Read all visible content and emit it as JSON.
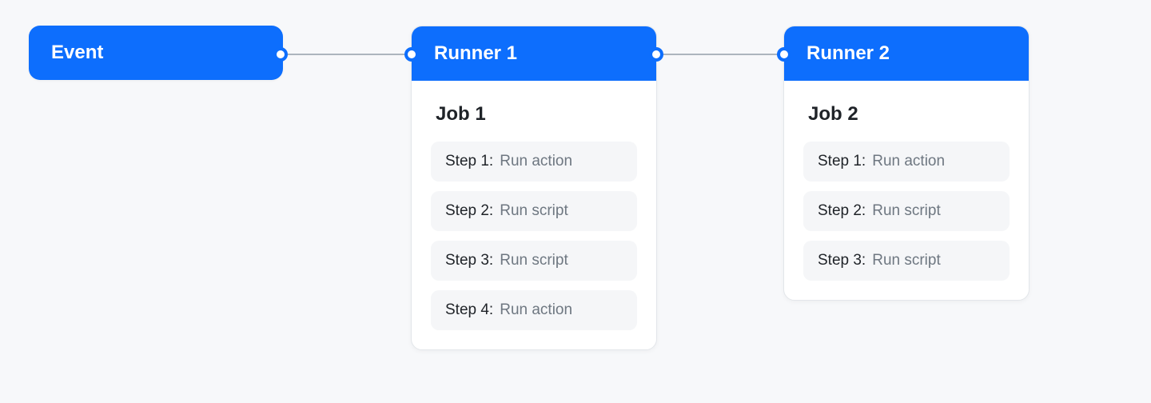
{
  "colors": {
    "accent": "#0d6efd",
    "background": "#f7f8fa",
    "card_bg": "#ffffff",
    "step_bg": "#f5f6f8",
    "text_primary": "#1f2328",
    "text_muted": "#6e7781",
    "connector": "#adb5bd"
  },
  "nodes": {
    "event": {
      "title": "Event"
    },
    "runner1": {
      "title": "Runner 1",
      "job_title": "Job 1",
      "steps": [
        {
          "label": "Step 1:",
          "desc": "Run action"
        },
        {
          "label": "Step 2:",
          "desc": "Run script"
        },
        {
          "label": "Step 3:",
          "desc": "Run script"
        },
        {
          "label": "Step 4:",
          "desc": "Run action"
        }
      ]
    },
    "runner2": {
      "title": "Runner 2",
      "job_title": "Job 2",
      "steps": [
        {
          "label": "Step 1:",
          "desc": "Run action"
        },
        {
          "label": "Step 2:",
          "desc": "Run script"
        },
        {
          "label": "Step 3:",
          "desc": "Run script"
        }
      ]
    }
  }
}
